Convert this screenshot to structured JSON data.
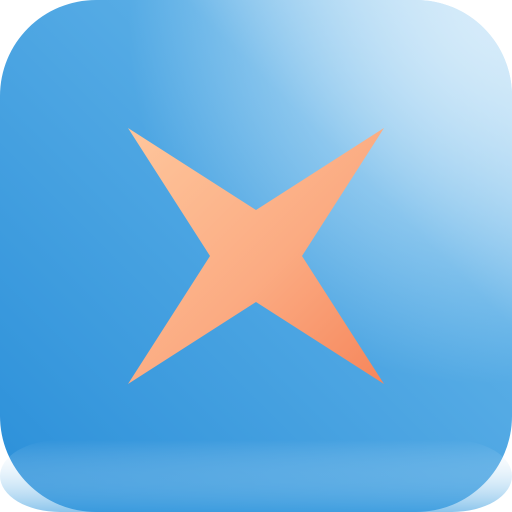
{
  "icon": {
    "name": "four-point-star-icon",
    "shape": "four-point-star",
    "background_colors": {
      "highlight": "#d7ecfa",
      "mid": "#5aaee6",
      "base": "#2a8fd9",
      "bottom_edge": "#3f9fe0"
    },
    "star_colors": {
      "light": "#fec69c",
      "mid": "#fbab82",
      "dark": "#f6865b"
    }
  }
}
